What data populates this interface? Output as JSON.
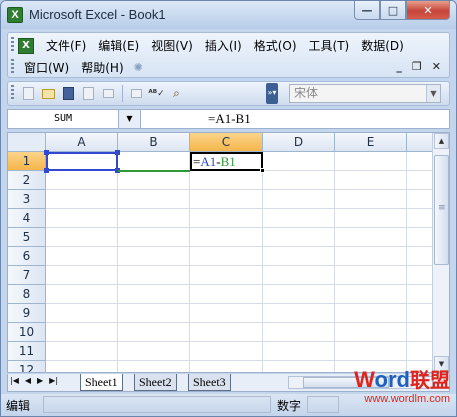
{
  "window": {
    "title": "Microsoft Excel - Book1",
    "app_icon": "excel-icon",
    "controls": {
      "minimize": "—",
      "maximize": "□",
      "close": "✕"
    }
  },
  "menubar": {
    "items": [
      {
        "label": "文件(F)"
      },
      {
        "label": "编辑(E)"
      },
      {
        "label": "视图(V)"
      },
      {
        "label": "插入(I)"
      },
      {
        "label": "格式(O)"
      },
      {
        "label": "工具(T)"
      },
      {
        "label": "数据(D)"
      }
    ],
    "items_row2": [
      {
        "label": "窗口(W)"
      },
      {
        "label": "帮助(H)"
      }
    ],
    "doc_controls": {
      "minimize": "_",
      "restore": "❐",
      "close": "✕"
    }
  },
  "toolbar": {
    "buttons": [
      "new-icon",
      "open-icon",
      "save-icon",
      "permission-icon",
      "print-icon",
      "print-preview-icon",
      "spelling-icon",
      "research-icon"
    ],
    "font_name": "宋体"
  },
  "formula_bar": {
    "name_box": "SUM",
    "formula": "=A1-B1"
  },
  "grid": {
    "columns": [
      "A",
      "B",
      "C",
      "D",
      "E"
    ],
    "active_column": "C",
    "rows": [
      "1",
      "2",
      "3",
      "4",
      "5",
      "6",
      "7",
      "8",
      "9",
      "10",
      "11",
      "12"
    ],
    "active_row": "1",
    "cell_C1": {
      "prefix": "=",
      "ref_a": "A1",
      "op": "-",
      "ref_b": "B1"
    }
  },
  "sheets": {
    "tabs": [
      "Sheet1",
      "Sheet2",
      "Sheet3"
    ],
    "active": "Sheet1",
    "nav": [
      "⏮",
      "◀",
      "▶",
      "⏭"
    ]
  },
  "statusbar": {
    "mode": "编辑",
    "indicator": "数字"
  },
  "watermark": {
    "w": "W",
    "ord": "ord",
    "cn": "联盟",
    "url": "www.wordlm.com"
  },
  "colors": {
    "ref_a": "#3049d0",
    "ref_b": "#2e9a38",
    "active_header": "#f5b64b"
  }
}
